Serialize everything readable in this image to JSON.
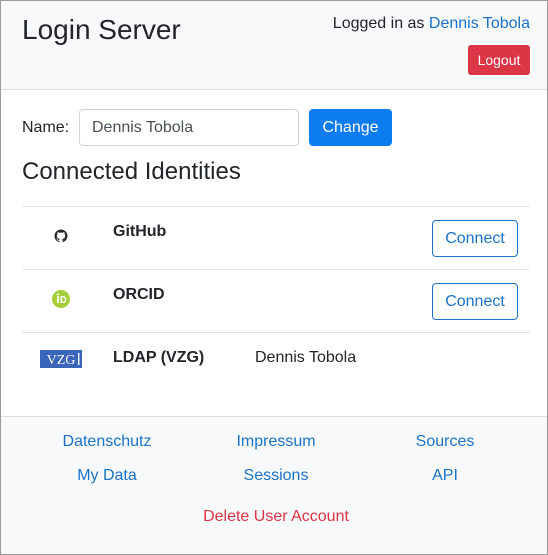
{
  "header": {
    "title": "Login Server",
    "logged_in_prefix": "Logged in as",
    "user_name": "Dennis Tobola",
    "logout_label": "Logout"
  },
  "name_form": {
    "label": "Name:",
    "value": "Dennis Tobola",
    "change_label": "Change"
  },
  "identities": {
    "title": "Connected Identities",
    "items": [
      {
        "icon": "github-icon",
        "name": "GitHub",
        "connect_label": "Connect"
      },
      {
        "icon": "orcid-icon",
        "name": "ORCID",
        "connect_label": "Connect"
      },
      {
        "icon": "vzg-logo",
        "logo_text": "VZG",
        "name": "LDAP (VZG)",
        "value": "Dennis Tobola"
      }
    ]
  },
  "footer": {
    "links": [
      "Datenschutz",
      "Impressum",
      "Sources",
      "My Data",
      "Sessions",
      "API"
    ],
    "delete_label": "Delete User Account"
  },
  "colors": {
    "primary": "#0d7cf0",
    "link": "#1a73c9",
    "danger": "#dc3545",
    "orcid": "#a6ce39",
    "vzg": "#3a65b8"
  }
}
